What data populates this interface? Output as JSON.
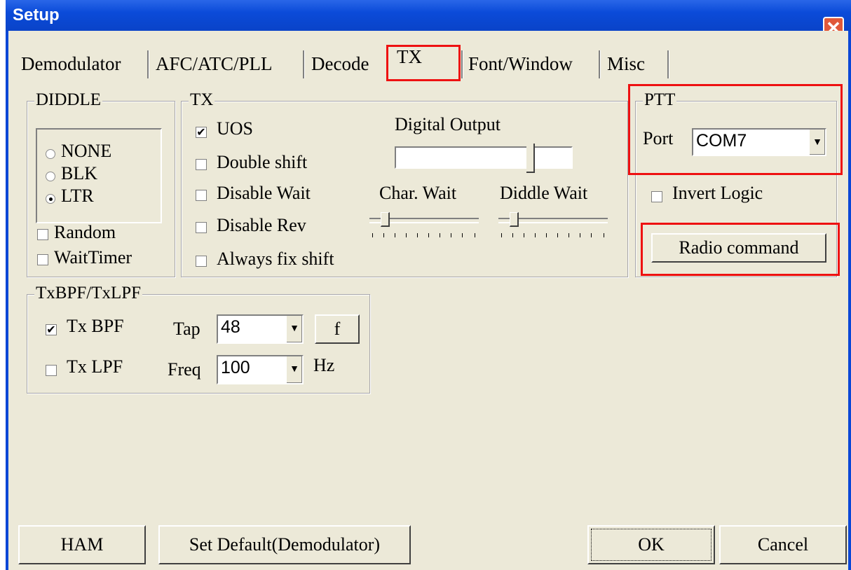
{
  "window": {
    "title": "Setup"
  },
  "tabs": [
    "Demodulator",
    "AFC/ATC/PLL",
    "Decode",
    "TX",
    "Font/Window",
    "Misc"
  ],
  "diddle": {
    "label": "DIDDLE",
    "options": [
      "NONE",
      "BLK",
      "LTR"
    ],
    "selected": "LTR",
    "random": {
      "label": "Random",
      "checked": false
    },
    "waittimer": {
      "label": "WaitTimer",
      "checked": false
    }
  },
  "tx": {
    "label": "TX",
    "uos": {
      "label": "UOS",
      "checked": true
    },
    "double_shift": {
      "label": "Double shift",
      "checked": false
    },
    "disable_wait": {
      "label": "Disable Wait",
      "checked": false
    },
    "disable_rev": {
      "label": "Disable Rev",
      "checked": false
    },
    "always_fix_shift": {
      "label": "Always fix shift",
      "checked": false
    },
    "digital_output_label": "Digital Output",
    "char_wait_label": "Char. Wait",
    "diddle_wait_label": "Diddle Wait"
  },
  "ptt": {
    "label": "PTT",
    "port_label": "Port",
    "port_value": "COM7",
    "invert_logic": {
      "label": "Invert Logic",
      "checked": false
    },
    "radio_command": "Radio command"
  },
  "filter": {
    "label": "TxBPF/TxLPF",
    "tx_bpf": {
      "label": "Tx BPF",
      "checked": true
    },
    "tx_lpf": {
      "label": "Tx LPF",
      "checked": false
    },
    "tap_label": "Tap",
    "tap_value": "48",
    "f_button": "f",
    "freq_label": "Freq",
    "freq_value": "100",
    "hz_label": "Hz"
  },
  "footer": {
    "ham": "HAM",
    "set_default": "Set Default(Demodulator)",
    "ok": "OK",
    "cancel": "Cancel"
  }
}
